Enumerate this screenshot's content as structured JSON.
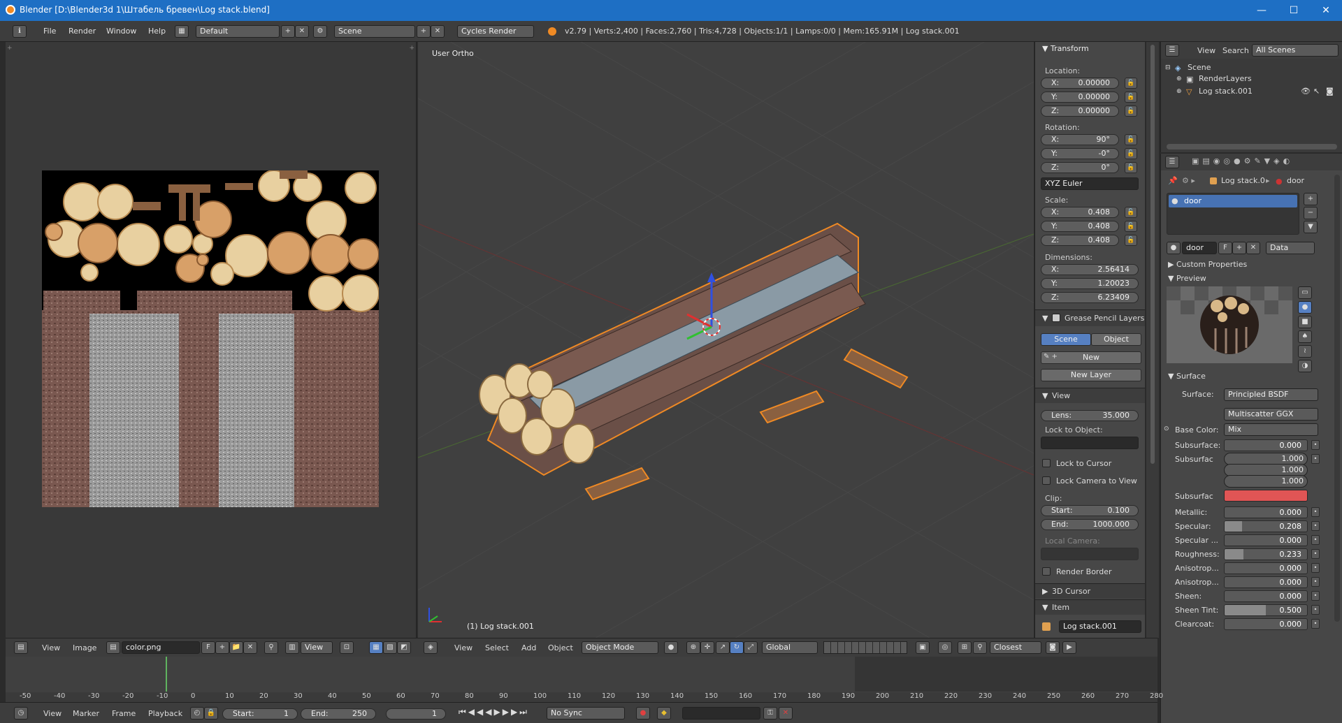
{
  "titlebar": {
    "title": "Blender [D:\\Blender3d 1\\Штабель бревен\\Log stack.blend]",
    "minimize": "—",
    "maximize": "☐",
    "close": "✕"
  },
  "topbar": {
    "menus": [
      "File",
      "Render",
      "Window",
      "Help"
    ],
    "layout": "Default",
    "scene": "Scene",
    "engine": "Cycles Render",
    "stats": "v2.79 | Verts:2,400 | Faces:2,760 | Tris:4,728 | Objects:1/1 | Lamps:0/0 | Mem:165.91M | Log stack.001"
  },
  "image_editor": {
    "header": {
      "view": "View",
      "image": "Image",
      "image_name": "color.png",
      "f_label": "F",
      "view2": "View"
    }
  },
  "viewport": {
    "label": "User Ortho",
    "object_label": "(1) Log stack.001",
    "header": {
      "view": "View",
      "select": "Select",
      "add": "Add",
      "object": "Object",
      "mode": "Object Mode",
      "orientation": "Global",
      "snap": "Closest"
    }
  },
  "npanel": {
    "transform_title": "Transform",
    "location_label": "Location:",
    "location": [
      {
        "axis": "X:",
        "value": "0.00000"
      },
      {
        "axis": "Y:",
        "value": "0.00000"
      },
      {
        "axis": "Z:",
        "value": "0.00000"
      }
    ],
    "rotation_label": "Rotation:",
    "rotation": [
      {
        "axis": "X:",
        "value": "90°"
      },
      {
        "axis": "Y:",
        "value": "-0°"
      },
      {
        "axis": "Z:",
        "value": "0°"
      }
    ],
    "rotation_mode": "XYZ Euler",
    "scale_label": "Scale:",
    "scale": [
      {
        "axis": "X:",
        "value": "0.408"
      },
      {
        "axis": "Y:",
        "value": "0.408"
      },
      {
        "axis": "Z:",
        "value": "0.408"
      }
    ],
    "dimensions_label": "Dimensions:",
    "dimensions": [
      {
        "axis": "X:",
        "value": "2.56414"
      },
      {
        "axis": "Y:",
        "value": "1.20023"
      },
      {
        "axis": "Z:",
        "value": "6.23409"
      }
    ],
    "grease_title": "Grease Pencil Layers",
    "gp_scene": "Scene",
    "gp_object": "Object",
    "gp_new": "New",
    "gp_new_layer": "New Layer",
    "view_title": "View",
    "lens": "Lens:",
    "lens_value": "35.000",
    "lock_to_object": "Lock to Object:",
    "lock_to_cursor": "Lock to Cursor",
    "lock_camera": "Lock Camera to View",
    "clip": "Clip:",
    "clip_start": "Start:",
    "clip_start_value": "0.100",
    "clip_end": "End:",
    "clip_end_value": "1000.000",
    "local_camera": "Local Camera:",
    "render_border": "Render Border",
    "cursor_title": "3D Cursor",
    "item_title": "Item",
    "item_name": "Log stack.001"
  },
  "outliner": {
    "view": "View",
    "search": "Search",
    "scenes": "All Scenes",
    "items": [
      "Scene",
      "RenderLayers",
      "Log stack.001"
    ]
  },
  "properties": {
    "breadcrumb_obj": "Log stack.0",
    "breadcrumb_mat": "door",
    "slot": "door",
    "mat_name": "door",
    "f": "F",
    "data": "Data",
    "custom_props": "Custom Properties",
    "preview": "Preview",
    "surface_title": "Surface",
    "surface_label": "Surface:",
    "surface_value": "Principled BSDF",
    "distribution": "Multiscatter GGX",
    "base_color_label": "Base Color:",
    "base_color_value": "Mix",
    "rows": [
      {
        "label": "Subsurface:",
        "value": "0.000",
        "fill": 0
      },
      {
        "label": "Metallic:",
        "value": "0.000",
        "fill": 0
      },
      {
        "label": "Specular:",
        "value": "0.208",
        "fill": 0.208
      },
      {
        "label": "Specular ...",
        "value": "0.000",
        "fill": 0
      },
      {
        "label": "Roughness:",
        "value": "0.233",
        "fill": 0.233
      },
      {
        "label": "Anisotrop...",
        "value": "0.000",
        "fill": 0
      },
      {
        "label": "Anisotrop...",
        "value": "0.000",
        "fill": 0
      },
      {
        "label": "Sheen:",
        "value": "0.000",
        "fill": 0
      },
      {
        "label": "Sheen Tint:",
        "value": "0.500",
        "fill": 0.5
      },
      {
        "label": "Clearcoat:",
        "value": "0.000",
        "fill": 0
      }
    ],
    "subsurface_radius_label": "Subsurfac",
    "subsurface_radius": [
      "1.000",
      "1.000",
      "1.000"
    ],
    "subsurface_color_label": "Subsurfac",
    "subsurface_color": "#e05555"
  },
  "timeline": {
    "ticks": [
      "-50",
      "-40",
      "-30",
      "-20",
      "-10",
      "0",
      "10",
      "20",
      "30",
      "40",
      "50",
      "60",
      "70",
      "80",
      "90",
      "100",
      "110",
      "120",
      "130",
      "140",
      "150",
      "160",
      "170",
      "180",
      "190",
      "200",
      "210",
      "220",
      "230",
      "240",
      "250",
      "260",
      "270",
      "280"
    ],
    "view": "View",
    "marker": "Marker",
    "frame": "Frame",
    "playback": "Playback",
    "start_label": "Start:",
    "start": "1",
    "end_label": "End:",
    "end": "250",
    "current": "1",
    "sync": "No Sync"
  },
  "colors": {
    "accent": "#5680c2",
    "orange": "#f08a24",
    "select": "#4772b3"
  }
}
